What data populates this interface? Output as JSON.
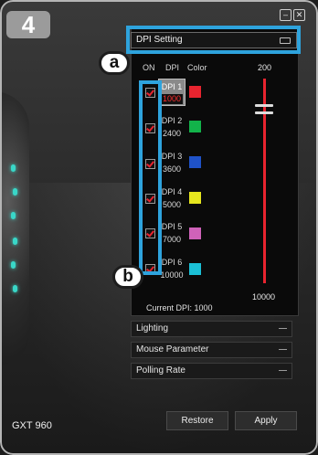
{
  "step_badge": "4",
  "callouts": {
    "a": "a",
    "b": "b"
  },
  "window": {
    "minimize_glyph": "–",
    "close_glyph": "✕"
  },
  "dpi_setting": {
    "title": "DPI Setting",
    "columns": {
      "on": "ON",
      "dpi": "DPI",
      "color": "Color"
    },
    "rows": [
      {
        "name": "DPI 1",
        "value": "1000",
        "enabled": true,
        "color": "#e8242f",
        "active": true
      },
      {
        "name": "DPI 2",
        "value": "2400",
        "enabled": true,
        "color": "#12b34a",
        "active": false
      },
      {
        "name": "DPI 3",
        "value": "3600",
        "enabled": true,
        "color": "#1f52c8",
        "active": false
      },
      {
        "name": "DPI 4",
        "value": "5000",
        "enabled": true,
        "color": "#e6e61e",
        "active": false
      },
      {
        "name": "DPI 5",
        "value": "7000",
        "enabled": true,
        "color": "#cf62b9",
        "active": false
      },
      {
        "name": "DPI 6",
        "value": "10000",
        "enabled": true,
        "color": "#1bc0d6",
        "active": false
      }
    ],
    "slider": {
      "max_label": "200",
      "min_label": "10000",
      "level": 0.85
    },
    "current_dpi_label": "Current DPI:",
    "current_dpi_value": "1000"
  },
  "sections": [
    {
      "label": "Lighting"
    },
    {
      "label": "Mouse Parameter"
    },
    {
      "label": "Polling Rate"
    }
  ],
  "footer": {
    "model": "GXT 960",
    "restore_label": "Restore",
    "apply_label": "Apply"
  }
}
